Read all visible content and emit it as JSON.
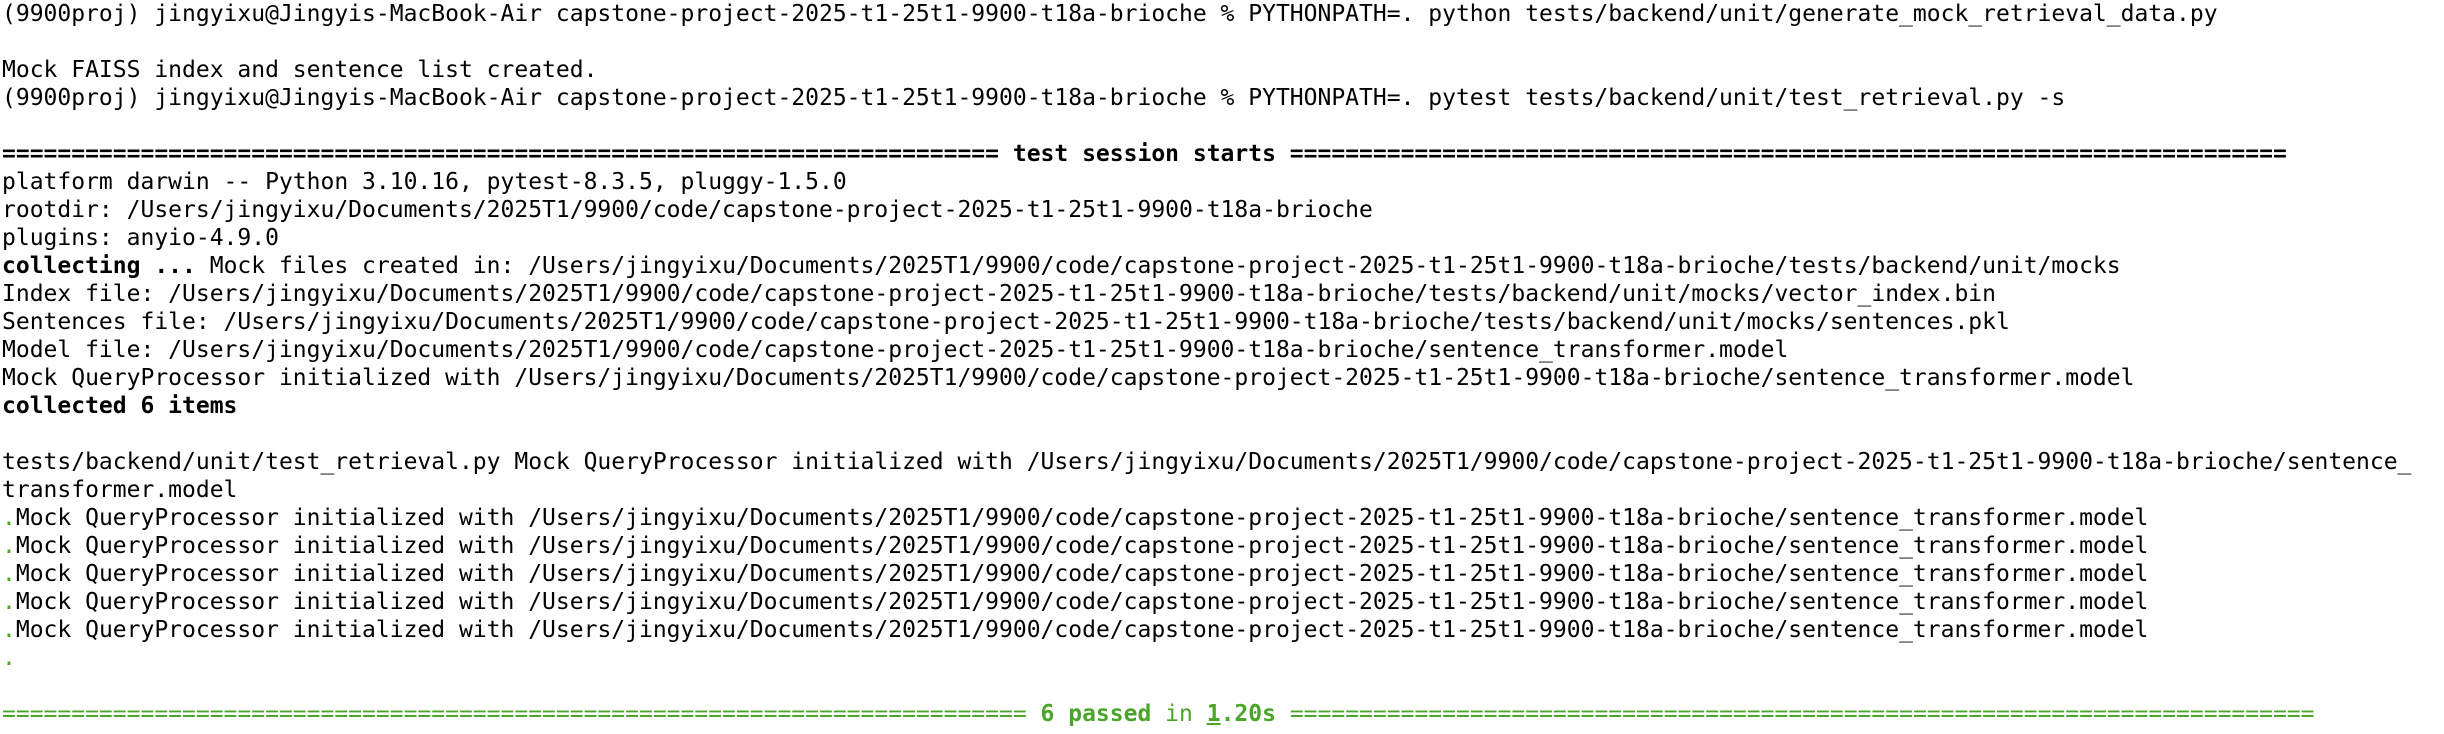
{
  "terminal": {
    "cmd1": "(9900proj) jingyixu@Jingyis-MacBook-Air capstone-project-2025-t1-25t1-9900-t18a-brioche % PYTHONPATH=. python tests/backend/unit/generate_mock_retrieval_data.py",
    "mock_created": "Mock FAISS index and sentence list created.",
    "cmd2": "(9900proj) jingyixu@Jingyis-MacBook-Air capstone-project-2025-t1-25t1-9900-t18a-brioche % PYTHONPATH=. pytest tests/backend/unit/test_retrieval.py -s",
    "session_sep_left": "======================================================================== ",
    "session_title": "test session starts",
    "session_sep_right": " ========================================================================",
    "platform": "platform darwin -- Python 3.10.16, pytest-8.3.5, pluggy-1.5.0",
    "rootdir": "rootdir: /Users/jingyixu/Documents/2025T1/9900/code/capstone-project-2025-t1-25t1-9900-t18a-brioche",
    "plugins": "plugins: anyio-4.9.0",
    "collecting_label": "collecting ...",
    "collecting_rest": " Mock files created in: /Users/jingyixu/Documents/2025T1/9900/code/capstone-project-2025-t1-25t1-9900-t18a-brioche/tests/backend/unit/mocks",
    "index_file": "Index file: /Users/jingyixu/Documents/2025T1/9900/code/capstone-project-2025-t1-25t1-9900-t18a-brioche/tests/backend/unit/mocks/vector_index.bin",
    "sentences_file": "Sentences file: /Users/jingyixu/Documents/2025T1/9900/code/capstone-project-2025-t1-25t1-9900-t18a-brioche/tests/backend/unit/mocks/sentences.pkl",
    "model_file": "Model file: /Users/jingyixu/Documents/2025T1/9900/code/capstone-project-2025-t1-25t1-9900-t18a-brioche/sentence_transformer.model",
    "mock_init": "Mock QueryProcessor initialized with /Users/jingyixu/Documents/2025T1/9900/code/capstone-project-2025-t1-25t1-9900-t18a-brioche/sentence_transformer.model",
    "collected": "collected 6 items",
    "test_file_line": "tests/backend/unit/test_retrieval.py Mock QueryProcessor initialized with /Users/jingyixu/Documents/2025T1/9900/code/capstone-project-2025-t1-25t1-9900-t18a-brioche/sentence_",
    "test_file_wrap": "transformer.model",
    "dot": ".",
    "result_lines": [
      "Mock QueryProcessor initialized with /Users/jingyixu/Documents/2025T1/9900/code/capstone-project-2025-t1-25t1-9900-t18a-brioche/sentence_transformer.model",
      "Mock QueryProcessor initialized with /Users/jingyixu/Documents/2025T1/9900/code/capstone-project-2025-t1-25t1-9900-t18a-brioche/sentence_transformer.model",
      "Mock QueryProcessor initialized with /Users/jingyixu/Documents/2025T1/9900/code/capstone-project-2025-t1-25t1-9900-t18a-brioche/sentence_transformer.model",
      "Mock QueryProcessor initialized with /Users/jingyixu/Documents/2025T1/9900/code/capstone-project-2025-t1-25t1-9900-t18a-brioche/sentence_transformer.model",
      "Mock QueryProcessor initialized with /Users/jingyixu/Documents/2025T1/9900/code/capstone-project-2025-t1-25t1-9900-t18a-brioche/sentence_transformer.model"
    ],
    "summary_sep_left": "========================================================================== ",
    "summary_passed": "6 passed",
    "summary_in": " in ",
    "summary_time_1": "1",
    "summary_time_rest": ".20s",
    "summary_sep_right": " ==========================================================================",
    "colors": {
      "green": "#4aa52a",
      "text": "#000000",
      "background": "#ffffff"
    }
  }
}
